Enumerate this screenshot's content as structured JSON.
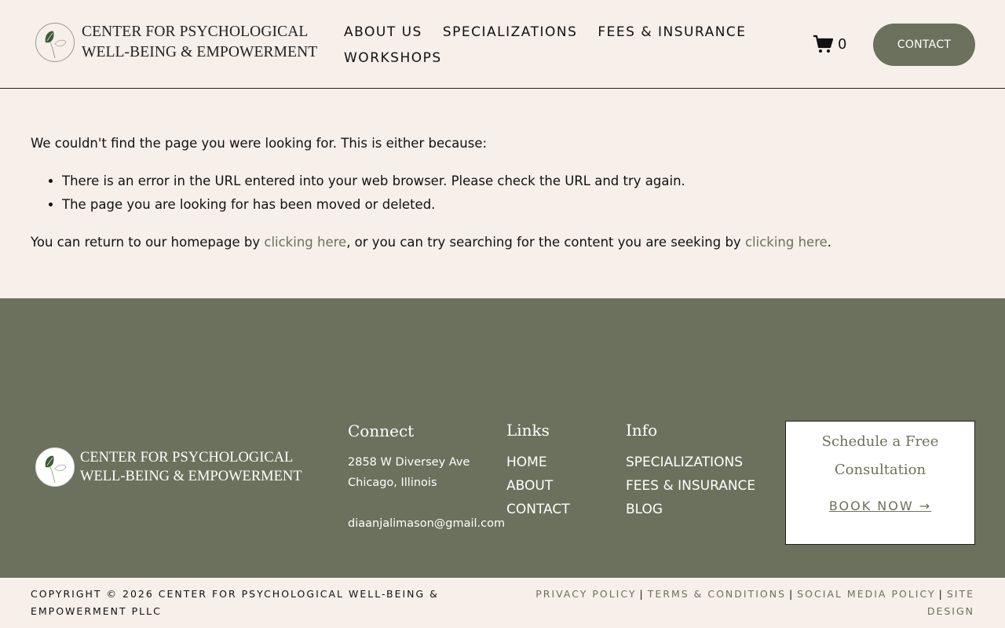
{
  "header": {
    "logo_line1": "CENTER FOR PSYCHOLOGICAL",
    "logo_line2": "WELL-BEING & EMPOWERMENT",
    "nav": [
      "ABOUT US",
      "SPECIALIZATIONS",
      "FEES & INSURANCE",
      "WORKSHOPS"
    ],
    "cart_count": "0",
    "contact_label": "CONTACT"
  },
  "main": {
    "intro": "We couldn't find the page you were looking for. This is either because:",
    "reasons": [
      "There is an error in the URL entered into your web browser. Please check the URL and try again.",
      "The page you are looking for has been moved or deleted."
    ],
    "return_prefix": "You can return to our homepage by ",
    "link1": "clicking here",
    "return_middle": ", or you can try searching for the content you are seeking by ",
    "link2": "clicking here",
    "return_suffix": "."
  },
  "footer": {
    "logo_line1": "CENTER FOR PSYCHOLOGICAL",
    "logo_line2": "WELL-BEING & EMPOWERMENT",
    "connect": {
      "heading": "Connect",
      "address1": "2858 W Diversey Ave",
      "address2": "Chicago, Illinois",
      "email": "diaanjalimason@gmail.com"
    },
    "links": {
      "heading": "Links",
      "items": [
        "HOME",
        "ABOUT",
        "CONTACT"
      ]
    },
    "info": {
      "heading": "Info",
      "items": [
        "SPECIALIZATIONS",
        "FEES & INSURANCE",
        "BLOG"
      ]
    },
    "cta": {
      "title": "Schedule a Free Consultation",
      "button": "BOOK NOW →"
    }
  },
  "bottom": {
    "copyright": "COPYRIGHT © 2026 CENTER FOR PSYCHOLOGICAL WELL-BEING & EMPOWERMENT PLLC",
    "legal": [
      "PRIVACY POLICY",
      "TERMS & CONDITIONS",
      "SOCIAL MEDIA POLICY",
      "SITE DESIGN"
    ],
    "separator": "|"
  },
  "colors": {
    "background": "#f6efea",
    "accent": "#6b715c",
    "text": "#111111"
  },
  "icons": [
    "leaf-logo-icon",
    "cart-icon"
  ]
}
